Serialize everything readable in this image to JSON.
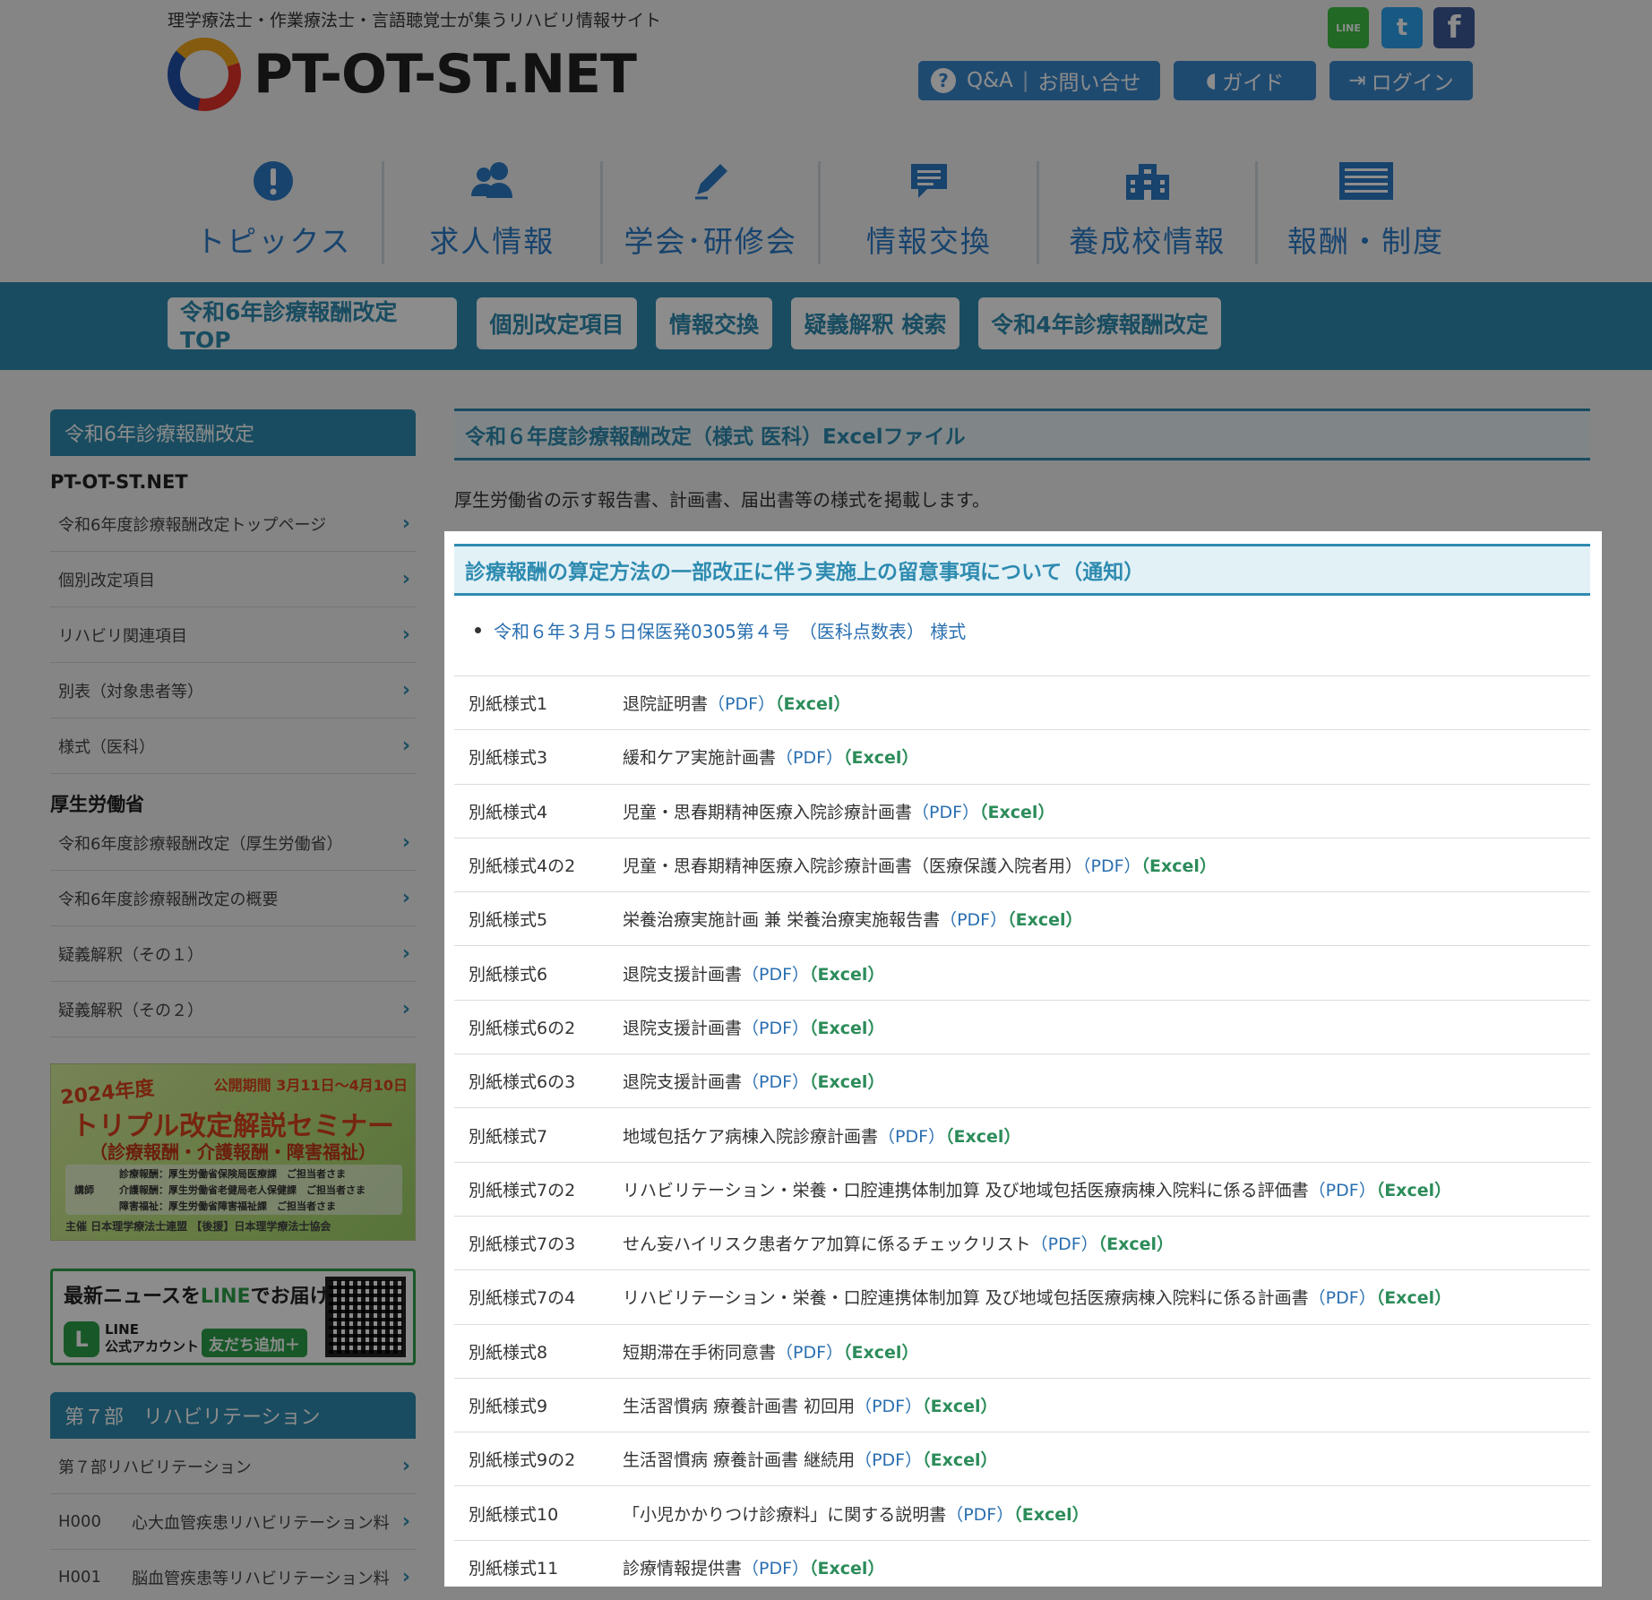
{
  "header": {
    "tagline": "理学療法士・作業療法士・言語聴覚士が集うリハビリ情報サイト",
    "logo_text": "PT-OT-ST.NET",
    "sns": {
      "line": "LINE",
      "twitter": "t",
      "facebook": "f"
    },
    "buttons": {
      "qa": "Q&A",
      "contact": "お問い合せ",
      "guide": "ガイド",
      "login": "ログイン"
    }
  },
  "main_nav": [
    {
      "label": "トピックス",
      "icon": "exclamation-icon"
    },
    {
      "label": "求人情報",
      "icon": "people-icon"
    },
    {
      "label": "学会･研修会",
      "icon": "pen-icon"
    },
    {
      "label": "情報交換",
      "icon": "chat-icon"
    },
    {
      "label": "養成校情報",
      "icon": "school-icon"
    },
    {
      "label": "報酬・制度",
      "icon": "list-icon"
    }
  ],
  "sub_nav": [
    "令和6年診療報酬改定TOP",
    "個別改定項目",
    "情報交換",
    "疑義解釈 検索",
    "令和4年診療報酬改定"
  ],
  "sidebar": {
    "section1_title": "令和6年診療報酬改定",
    "group1": "PT-OT-ST.NET",
    "group1_links": [
      "令和6年度診療報酬改定トップページ",
      "個別改定項目",
      "リハビリ関連項目",
      "別表（対象患者等）",
      "様式（医科）"
    ],
    "group2": "厚生労働省",
    "group2_links": [
      "令和6年度診療報酬改定（厚生労働省）",
      "令和6年度診療報酬改定の概要",
      "疑義解釈（その１）",
      "疑義解釈（その２）"
    ],
    "banner_seminar": {
      "year": "2024年度",
      "period": "公開期間 3月11日〜4月10日",
      "title": "トリプル改定解説セミナー",
      "subtitle": "（診療報酬・介護報酬・障害福祉）",
      "lecturers": [
        "診療報酬：厚生労働省保険局医療課　ご担当者さま",
        "介護報酬：厚生労働省老健局老人保健課　ご担当者さま",
        "障害福祉：厚生労働省障害福祉課　ご担当者さま"
      ],
      "lecturer_label": "講師",
      "footer": "主催 日本理学療法士連盟 【後援】日本理学療法士協会"
    },
    "banner_line": {
      "title_a": "最新ニュースを",
      "title_line": "LINE",
      "title_b": "でお届け",
      "account": "LINE\n公式アカウント",
      "add": "友だち追加＋"
    },
    "section2_title": "第７部　リハビリテーション",
    "section2_links": [
      {
        "label": "第７部リハビリテーション"
      },
      {
        "code": "H000",
        "label": "心大血管疾患リハビリテーション料"
      },
      {
        "code": "H001",
        "label": "脳血管疾患等リハビリテーション料"
      }
    ]
  },
  "content": {
    "title": "令和６年度診療報酬改定（様式 医科）Excelファイル",
    "intro": "厚生労働省の示す報告書、計画書、届出書等の様式を掲載します。",
    "section_title": "診療報酬の算定方法の一部改正に伴う実施上の留意事項について（通知）",
    "bullet": "令和６年３月５日保医発0305第４号　（医科点数表） 様式",
    "pdf_label": "（PDF）",
    "excel_label": "（Excel）",
    "rows": [
      {
        "code": "別紙様式1",
        "name": "退院証明書"
      },
      {
        "code": "別紙様式3",
        "name": "緩和ケア実施計画書"
      },
      {
        "code": "別紙様式4",
        "name": "児童・思春期精神医療入院診療計画書"
      },
      {
        "code": "別紙様式4の2",
        "name": "児童・思春期精神医療入院診療計画書（医療保護入院者用）"
      },
      {
        "code": "別紙様式5",
        "name": "栄養治療実施計画 兼 栄養治療実施報告書"
      },
      {
        "code": "別紙様式6",
        "name": "退院支援計画書"
      },
      {
        "code": "別紙様式6の2",
        "name": "退院支援計画書"
      },
      {
        "code": "別紙様式6の3",
        "name": "退院支援計画書"
      },
      {
        "code": "別紙様式7",
        "name": "地域包括ケア病棟入院診療計画書"
      },
      {
        "code": "別紙様式7の2",
        "name": "リハビリテーション・栄養・口腔連携体制加算 及び地域包括医療病棟入院料に係る評価書"
      },
      {
        "code": "別紙様式7の3",
        "name": "せん妄ハイリスク患者ケア加算に係るチェックリスト"
      },
      {
        "code": "別紙様式7の4",
        "name": "リハビリテーション・栄養・口腔連携体制加算 及び地域包括医療病棟入院料に係る計画書"
      },
      {
        "code": "別紙様式8",
        "name": "短期滞在手術同意書"
      },
      {
        "code": "別紙様式9",
        "name": "生活習慣病 療養計画書 初回用"
      },
      {
        "code": "別紙様式9の2",
        "name": "生活習慣病 療養計画書 継続用"
      },
      {
        "code": "別紙様式10",
        "name": "「小児かかりつけ診療料」に関する説明書"
      },
      {
        "code": "別紙様式11",
        "name": "診療情報提供書"
      }
    ]
  }
}
